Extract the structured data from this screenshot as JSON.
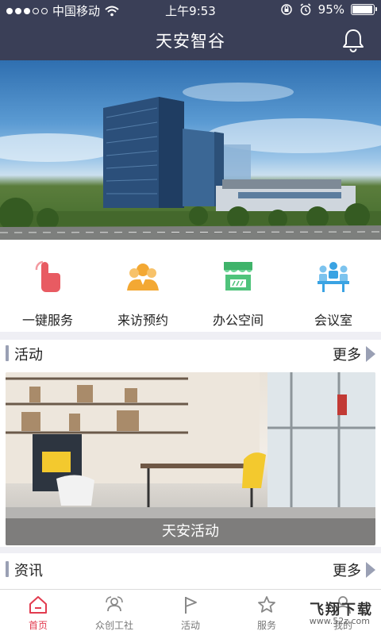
{
  "status_bar": {
    "carrier": "中国移动",
    "time": "上午9:53",
    "battery_percent": "95%",
    "battery_level": 0.95,
    "signal_dots": 3
  },
  "header": {
    "title": "天安智谷",
    "bell_icon": "bell-icon"
  },
  "quick_actions": [
    {
      "label": "一键服务",
      "icon": "hand-tap-icon",
      "color": "#e85b62"
    },
    {
      "label": "来访预约",
      "icon": "visitors-icon",
      "color": "#f3a833"
    },
    {
      "label": "办公空间",
      "icon": "storefront-icon",
      "color": "#4fc37b"
    },
    {
      "label": "会议室",
      "icon": "meeting-room-icon",
      "color": "#3aa3e3"
    }
  ],
  "sections": {
    "activity": {
      "title": "活动",
      "more": "更多",
      "caption": "天安活动"
    },
    "news": {
      "title": "资讯",
      "more": "更多"
    }
  },
  "tabbar": {
    "tabs": [
      {
        "label": "首页",
        "icon": "home-icon",
        "active": true
      },
      {
        "label": "众创工社",
        "icon": "community-icon",
        "active": false
      },
      {
        "label": "活动",
        "icon": "flag-icon",
        "active": false
      },
      {
        "label": "服务",
        "icon": "star-icon",
        "active": false
      },
      {
        "label": "我的",
        "icon": "user-icon",
        "active": false
      }
    ]
  },
  "watermark": {
    "main": "飞翔下载",
    "sub": "www.52z.com"
  },
  "colors": {
    "header_bg": "#3a3f57",
    "active_tab": "#e23b4f",
    "divider": "#efeff4",
    "section_accent": "#9aa0b4"
  }
}
